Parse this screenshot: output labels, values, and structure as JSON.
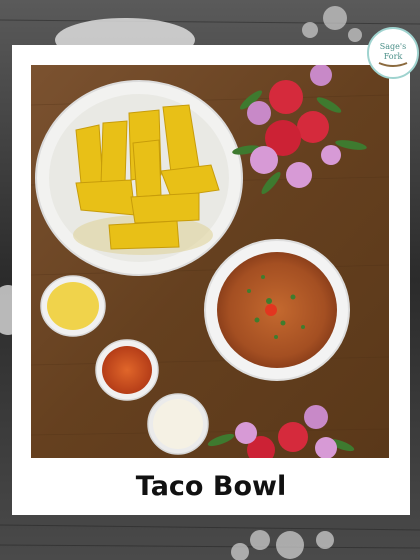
{
  "caption": "Taco Bowl",
  "logo": {
    "line1": "Sage's",
    "line2": "Fork",
    "name": "sage-fork-logo"
  },
  "colors": {
    "table": "#6b4526",
    "chips": "#e9c11a",
    "salsa": "#c84a1f",
    "beans": "#b55a2c",
    "frame": "#ffffff"
  }
}
